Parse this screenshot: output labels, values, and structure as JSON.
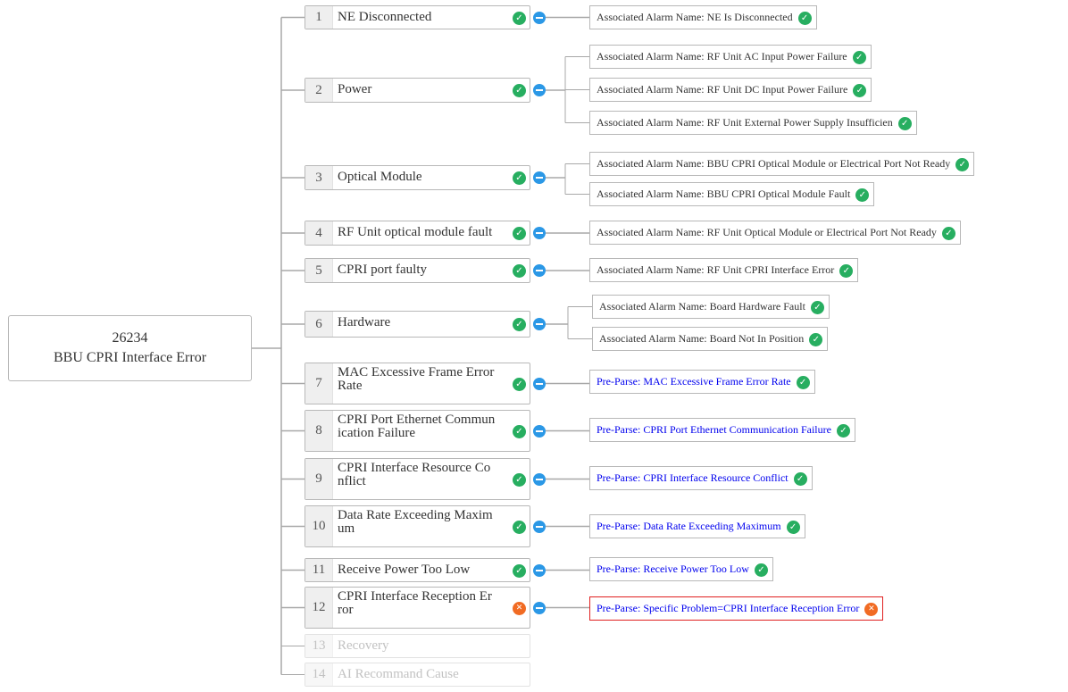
{
  "root": {
    "line1": "26234",
    "line2": "BBU CPRI Interface Error"
  },
  "nodes": [
    {
      "num": "1",
      "label": "NE Disconnected",
      "status": "ok",
      "alarms": [
        {
          "text": "Associated Alarm Name: NE Is Disconnected",
          "kind": "associated",
          "status": "ok"
        }
      ]
    },
    {
      "num": "2",
      "label": "Power",
      "status": "ok",
      "alarms": [
        {
          "text": "Associated Alarm Name: RF Unit AC Input Power Failure",
          "kind": "associated",
          "status": "ok"
        },
        {
          "text": "Associated Alarm Name: RF Unit DC Input Power Failure",
          "kind": "associated",
          "status": "ok"
        },
        {
          "text": "Associated Alarm Name: RF Unit External Power Supply Insufficien",
          "kind": "associated",
          "status": "ok"
        }
      ]
    },
    {
      "num": "3",
      "label": "Optical Module",
      "status": "ok",
      "alarms": [
        {
          "text": "Associated Alarm Name: BBU CPRI Optical Module or Electrical Port Not Ready",
          "kind": "associated",
          "status": "ok"
        },
        {
          "text": "Associated Alarm Name: BBU CPRI Optical Module Fault",
          "kind": "associated",
          "status": "ok"
        }
      ]
    },
    {
      "num": "4",
      "label": "RF Unit optical module fault",
      "status": "ok",
      "alarms": [
        {
          "text": "Associated Alarm Name: RF Unit Optical Module or Electrical Port Not Ready",
          "kind": "associated",
          "status": "ok"
        }
      ]
    },
    {
      "num": "5",
      "label": "CPRI port faulty",
      "status": "ok",
      "alarms": [
        {
          "text": "Associated Alarm Name: RF Unit CPRI Interface Error",
          "kind": "associated",
          "status": "ok"
        }
      ]
    },
    {
      "num": "6",
      "label": "Hardware",
      "status": "ok",
      "alarms": [
        {
          "text": "Associated Alarm Name: Board Hardware Fault",
          "kind": "associated",
          "status": "ok"
        },
        {
          "text": "Associated Alarm Name: Board Not In Position",
          "kind": "associated",
          "status": "ok"
        }
      ]
    },
    {
      "num": "7",
      "label": "MAC Excessive Frame Error\nRate",
      "status": "ok",
      "alarms": [
        {
          "text": "Pre-Parse: MAC Excessive Frame Error Rate",
          "kind": "pre-parse",
          "status": "ok"
        }
      ]
    },
    {
      "num": "8",
      "label": "CPRI Port Ethernet Commun\nication Failure",
      "status": "ok",
      "alarms": [
        {
          "text": "Pre-Parse: CPRI Port Ethernet Communication Failure",
          "kind": "pre-parse",
          "status": "ok"
        }
      ]
    },
    {
      "num": "9",
      "label": "CPRI Interface Resource Co\nnflict",
      "status": "ok",
      "alarms": [
        {
          "text": "Pre-Parse: CPRI Interface Resource Conflict",
          "kind": "pre-parse",
          "status": "ok"
        }
      ]
    },
    {
      "num": "10",
      "label": "Data Rate Exceeding Maxim\num",
      "status": "ok",
      "alarms": [
        {
          "text": "Pre-Parse: Data Rate Exceeding Maximum",
          "kind": "pre-parse",
          "status": "ok"
        }
      ]
    },
    {
      "num": "11",
      "label": "Receive Power Too Low",
      "status": "ok",
      "alarms": [
        {
          "text": "Pre-Parse: Receive Power Too Low",
          "kind": "pre-parse",
          "status": "ok"
        }
      ]
    },
    {
      "num": "12",
      "label": "CPRI Interface Reception Er\nror",
      "status": "error",
      "alarms": [
        {
          "text": "Pre-Parse: Specific Problem=CPRI Interface Reception Error",
          "kind": "pre-parse",
          "status": "error"
        }
      ]
    },
    {
      "num": "13",
      "label": "Recovery",
      "status": "disabled",
      "alarms": []
    },
    {
      "num": "14",
      "label": "AI Recommand Cause",
      "status": "disabled",
      "alarms": []
    }
  ],
  "colors": {
    "ok": "#27ae60",
    "error": "#f16b23",
    "collapse": "#2b98e6",
    "pre_parse_text": "#0000ee",
    "error_border": "#e02020"
  }
}
